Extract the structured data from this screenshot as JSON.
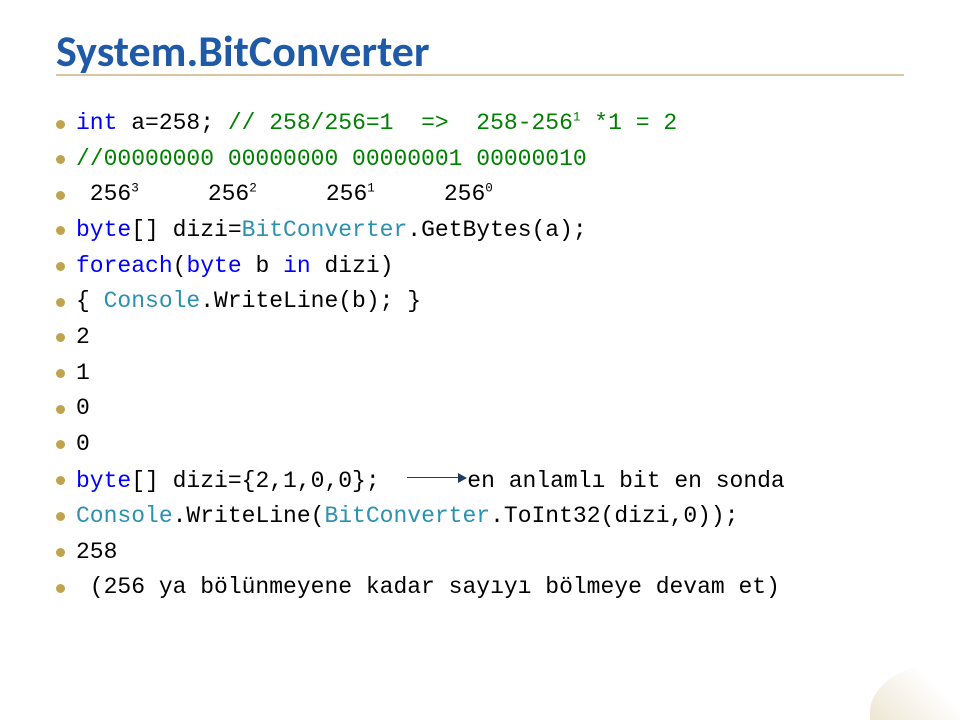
{
  "title": "System.BitConverter",
  "lines": {
    "l0_a": "int",
    "l0_b": " a=258; ",
    "l0_c": "// 258/256=1  =>  258-256",
    "l0_c_sup": "1",
    "l0_d": " *1 = 2",
    "l1": "//00000000 00000000 00000001 00000010",
    "l2_a": " 256",
    "l2_s3": "3",
    "l2_b": "     256",
    "l2_s2": "2",
    "l2_c": "     256",
    "l2_s1": "1",
    "l2_d": "     256",
    "l2_s0": "0",
    "l3_a": "byte",
    "l3_b": "[] dizi=",
    "l3_c": "BitConverter",
    "l3_d": ".GetBytes(a);",
    "l4_a": "foreach",
    "l4_b": "(",
    "l4_c": "byte",
    "l4_d": " b ",
    "l4_e": "in",
    "l4_f": " dizi)",
    "l5_a": "{ ",
    "l5_b": "Console",
    "l5_c": ".WriteLine(b); }",
    "l6": "2",
    "l7": "1",
    "l8": "0",
    "l9": "0",
    "l10_a": "byte",
    "l10_b": "[] dizi={2,1,0,0};",
    "l10_c": "en anlamlı bit en sonda",
    "l11_a": "Console",
    "l11_b": ".WriteLine(",
    "l11_c": "BitConverter",
    "l11_d": ".ToInt32(dizi,0));",
    "l12": "258",
    "l13": " (256 ya bölünmeyene kadar sayıyı bölmeye devam et)"
  }
}
